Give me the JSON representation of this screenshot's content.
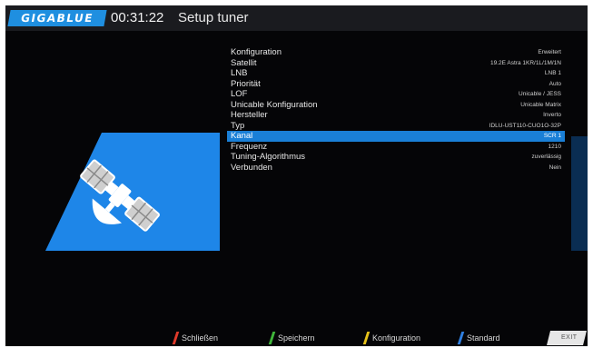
{
  "header": {
    "logo": "GIGABLUE",
    "time": "00:31:22",
    "title": "Setup tuner"
  },
  "settings": [
    {
      "label": "Konfiguration",
      "value": "Erweitert"
    },
    {
      "label": "Satellit",
      "value": "19.2E Astra 1KR/1L/1M/1N"
    },
    {
      "label": "LNB",
      "value": "LNB 1"
    },
    {
      "label": "Priorität",
      "value": "Auto"
    },
    {
      "label": "LOF",
      "value": "Unicable / JESS"
    },
    {
      "label": "Unicable Konfiguration",
      "value": "Unicable Matrix"
    },
    {
      "label": "Hersteller",
      "value": "Inverto"
    },
    {
      "label": "Typ",
      "value": "IDLU-UST110-CUO1O-32P"
    },
    {
      "label": "Kanal",
      "value": "SCR 1",
      "selected": true
    },
    {
      "label": "Frequenz",
      "value": "1210"
    },
    {
      "label": "Tuning-Algorithmus",
      "value": "zuverlässig"
    },
    {
      "label": "Verbunden",
      "value": "Nein"
    }
  ],
  "footer": {
    "red": "Schließen",
    "green": "Speichern",
    "yellow": "Konfiguration",
    "blue": "Standard",
    "exit": "EXIT"
  },
  "colors": {
    "accent": "#1a7fd6",
    "red": "#e03a2a",
    "green": "#3fb53a",
    "yellow": "#e6c21a",
    "blue": "#2f7fe0"
  },
  "icons": {
    "illustration": "satellite-icon"
  }
}
